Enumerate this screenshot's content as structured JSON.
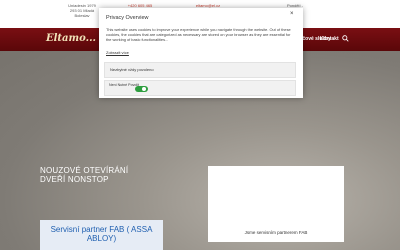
{
  "topbar": {
    "address_line1": "Uniadesin 1979",
    "address_line2": "293 01 Mladá",
    "address_line3": "Boleslav",
    "phone": "+420 605 465",
    "phone_sub": "...",
    "email": "eltamo@el.cz",
    "hours": "Pondělí -",
    "hours_sub": "..."
  },
  "nav": {
    "logo": "Eltamo...",
    "items": [
      "Klíčové služby",
      "Kontakt"
    ],
    "search_icon": "search-icon"
  },
  "hero": {
    "title": "NOUZOVÉ OTEVÍRÁNÍ DVEŘÍ NONSTOP",
    "partner": "Servisní partner FAB ( ASSA ABLOY)",
    "panel_caption": "Jsme servisním partnerem FAB"
  },
  "modal": {
    "title": "Privacy Overview",
    "close": "×",
    "body": "This website uses cookies to improve your experience while you navigate through the website. Out of these cookies, the cookies that are categorized as necessary are stored on your browser as they are essential for the working of basic functionalities...",
    "show_more": "Zobrazit více",
    "category1": "Nezbytné vždy povoleno",
    "category2": "Není Nutné Povolit",
    "toggle_state": "on"
  },
  "colors": {
    "navbar": "#6a0b0e",
    "toggle": "#2e9e3f",
    "partner_text": "#1f5fb0"
  }
}
